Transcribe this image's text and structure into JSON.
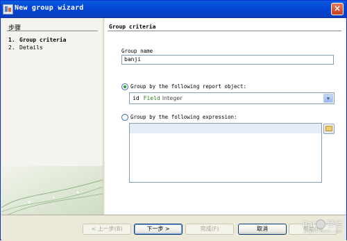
{
  "window": {
    "title": "New group wizard",
    "close_glyph": "×"
  },
  "sidebar": {
    "title": "步骤",
    "steps": [
      {
        "num": "1.",
        "label": "Group criteria"
      },
      {
        "num": "2.",
        "label": "Details"
      }
    ]
  },
  "page": {
    "heading": "Group criteria",
    "group_name_label": "Group name",
    "group_name_value": "banji",
    "option_report_object_label": "Group by the following report object:",
    "report_object": {
      "name": "id",
      "keyword": "Field",
      "type": "Integer"
    },
    "option_expression_label": "Group by the following expression:",
    "expression_value": ""
  },
  "buttons": {
    "back": "< 上一步(B)",
    "next": "下一步 >",
    "finish": "完成(F)",
    "cancel": "取消",
    "help": "帮助(H)"
  },
  "watermark": {
    "text": "Bai",
    "text2": "经验",
    "sub": "jingyan.baidu.com"
  },
  "icons": {
    "window": "wizard-window-icon",
    "dropdown": "chevron-down-icon",
    "expression_builder": "expression-builder-icon"
  }
}
